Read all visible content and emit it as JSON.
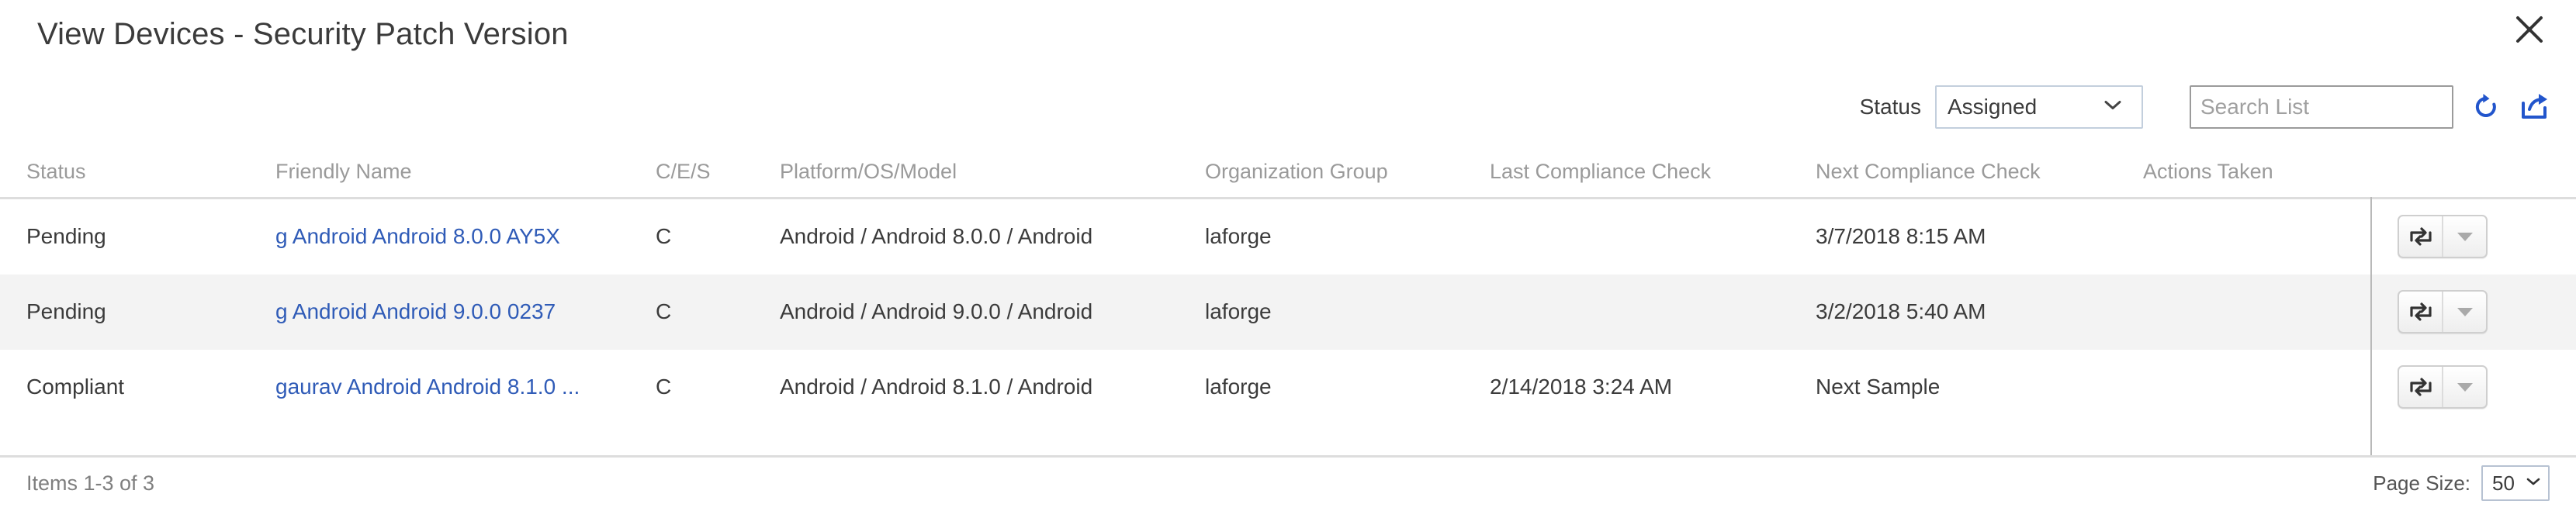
{
  "header": {
    "title": "View Devices - Security Patch Version",
    "close_icon": "close-icon"
  },
  "toolbar": {
    "status_label": "Status",
    "status_value": "Assigned",
    "status_options": [
      "Assigned"
    ],
    "search_placeholder": "Search List",
    "search_value": "",
    "refresh_icon": "refresh-icon",
    "export_icon": "export-icon",
    "accent_color": "#2255cc"
  },
  "table": {
    "columns": [
      "Status",
      "Friendly Name",
      "C/E/S",
      "Platform/OS/Model",
      "Organization Group",
      "Last Compliance Check",
      "Next Compliance Check",
      "Actions Taken"
    ],
    "rows": [
      {
        "status": "Pending",
        "friendly_name": "g Android Android 8.0.0 AY5X",
        "ces": "C",
        "platform": "Android / Android 8.0.0 / Android",
        "org_group": "laforge",
        "last_check": "",
        "next_check": "3/7/2018 8:15 AM",
        "actions_taken": "",
        "action_icon": "sync-icon",
        "action_caret_icon": "caret-down-icon"
      },
      {
        "status": "Pending",
        "friendly_name": "g Android Android 9.0.0 0237",
        "ces": "C",
        "platform": "Android / Android 9.0.0 / Android",
        "org_group": "laforge",
        "last_check": "",
        "next_check": "3/2/2018 5:40 AM",
        "actions_taken": "",
        "action_icon": "sync-icon",
        "action_caret_icon": "caret-down-icon"
      },
      {
        "status": "Compliant",
        "friendly_name": "gaurav Android Android 8.1.0 ...",
        "ces": "C",
        "platform": "Android / Android 8.1.0 / Android",
        "org_group": "laforge",
        "last_check": "2/14/2018 3:24 AM",
        "next_check": "Next Sample",
        "actions_taken": "",
        "action_icon": "sync-icon",
        "action_caret_icon": "caret-down-icon"
      }
    ],
    "link_color": "#2f5bb7",
    "header_color": "#9a9a9a",
    "alt_row_color": "#f3f3f3"
  },
  "footer": {
    "items_count": "Items 1-3 of 3",
    "page_size_label": "Page Size:",
    "page_size_value": "50",
    "page_size_options": [
      "50"
    ]
  }
}
